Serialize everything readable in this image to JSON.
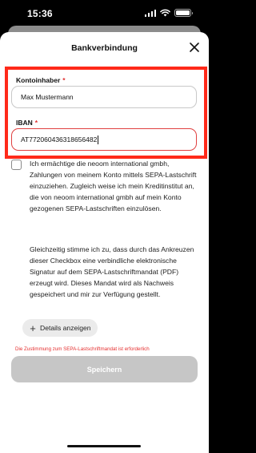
{
  "status_bar": {
    "time": "15:36"
  },
  "sheet": {
    "title": "Bankverbindung"
  },
  "form": {
    "account_holder": {
      "label": "Kontoinhaber",
      "required_mark": "*",
      "value": "Max Mustermann"
    },
    "iban": {
      "label": "IBAN",
      "required_mark": "*",
      "value": "AT772060436318656482"
    }
  },
  "consent": {
    "paragraph1": "Ich ermächtige die neoom international gmbh, Zahlungen von meinem Konto mittels SEPA-Lastschrift einzuziehen. Zugleich weise ich mein Kreditinstitut an, die von neoom international gmbh auf mein Konto gezogenen SEPA-Lastschriften einzulösen.",
    "paragraph2": "Gleichzeitig stimme ich zu, dass durch das Ankreuzen dieser Checkbox eine verbindliche elektronische Signatur auf dem SEPA-Lastschriftmandat (PDF) erzeugt wird. Dieses Mandat wird als Nachweis gespeichert und mir zur Verfügung gestellt.",
    "checked": false
  },
  "details_button": {
    "label": "Details anzeigen"
  },
  "error_message": "Die Zustimmung zum SEPA-Lastschriftmandat ist erforderlich",
  "save_button": {
    "label": "Speichern"
  },
  "colors": {
    "highlight": "#ff2a1a",
    "error": "#e53030",
    "save_disabled": "#c6c6c6"
  }
}
